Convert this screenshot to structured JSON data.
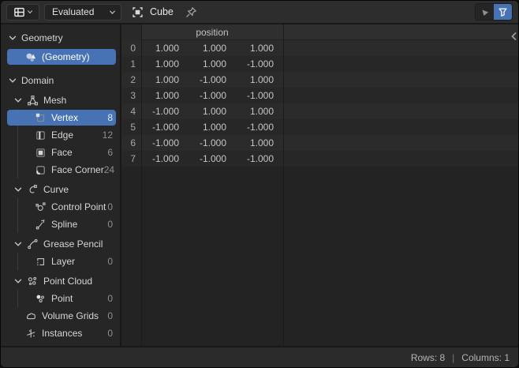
{
  "topbar": {
    "data_source_value": "Evaluated",
    "object_name": "Cube"
  },
  "sidebar": {
    "items": [
      {
        "label": "Geometry",
        "type": "section",
        "chevron": true
      },
      {
        "label": "(Geometry)",
        "type": "item",
        "level": 1,
        "icon": "geometry-set-icon",
        "selected": true
      },
      {
        "label": "Domain",
        "type": "section",
        "chevron": true
      },
      {
        "label": "Mesh",
        "type": "subsection",
        "icon": "mesh-data-icon",
        "chevron": true
      },
      {
        "label": "Vertex",
        "type": "item",
        "level": 2,
        "icon": "vertex-icon",
        "count": "8",
        "selected": true
      },
      {
        "label": "Edge",
        "type": "item",
        "level": 2,
        "icon": "edge-icon",
        "count": "12"
      },
      {
        "label": "Face",
        "type": "item",
        "level": 2,
        "icon": "face-icon",
        "count": "6"
      },
      {
        "label": "Face Corner",
        "type": "item",
        "level": 2,
        "icon": "face-corner-icon",
        "count": "24"
      },
      {
        "label": "Curve",
        "type": "subsection",
        "icon": "curve-data-icon",
        "chevron": true
      },
      {
        "label": "Control Point",
        "type": "item",
        "level": 2,
        "icon": "control-point-icon",
        "count": "0"
      },
      {
        "label": "Spline",
        "type": "item",
        "level": 2,
        "icon": "spline-icon",
        "count": "0"
      },
      {
        "label": "Grease Pencil",
        "type": "subsection",
        "icon": "grease-pencil-icon",
        "chevron": true
      },
      {
        "label": "Layer",
        "type": "item",
        "level": 2,
        "icon": "layer-icon",
        "count": "0"
      },
      {
        "label": "Point Cloud",
        "type": "subsection",
        "icon": "point-cloud-icon",
        "chevron": true
      },
      {
        "label": "Point",
        "type": "item",
        "level": 2,
        "icon": "point-icon",
        "count": "0"
      },
      {
        "label": "Volume Grids",
        "type": "item",
        "level": 1,
        "icon": "volume-grids-icon",
        "count": "0"
      },
      {
        "label": "Instances",
        "type": "item",
        "level": 1,
        "icon": "instances-icon",
        "count": "0"
      }
    ]
  },
  "table": {
    "group_header": "position",
    "rows": [
      {
        "index": "0",
        "values": [
          "1.000",
          "1.000",
          "1.000"
        ]
      },
      {
        "index": "1",
        "values": [
          "1.000",
          "1.000",
          "-1.000"
        ]
      },
      {
        "index": "2",
        "values": [
          "1.000",
          "-1.000",
          "1.000"
        ]
      },
      {
        "index": "3",
        "values": [
          "1.000",
          "-1.000",
          "-1.000"
        ]
      },
      {
        "index": "4",
        "values": [
          "-1.000",
          "1.000",
          "1.000"
        ]
      },
      {
        "index": "5",
        "values": [
          "-1.000",
          "1.000",
          "-1.000"
        ]
      },
      {
        "index": "6",
        "values": [
          "-1.000",
          "-1.000",
          "1.000"
        ]
      },
      {
        "index": "7",
        "values": [
          "-1.000",
          "-1.000",
          "-1.000"
        ]
      }
    ]
  },
  "statusbar": {
    "rows_label": "Rows: 8",
    "separator": "|",
    "columns_label": "Columns: 1"
  },
  "colors": {
    "accent_blue": "#4772b3",
    "selected_text": "#ffffff"
  }
}
